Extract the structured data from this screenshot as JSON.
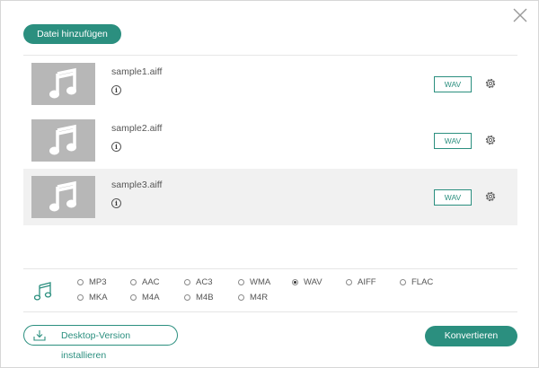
{
  "header": {
    "add_button_label": "Datei hinzufügen"
  },
  "files": [
    {
      "name": "sample1.aiff",
      "format": "WAV"
    },
    {
      "name": "sample2.aiff",
      "format": "WAV"
    },
    {
      "name": "sample3.aiff",
      "format": "WAV"
    }
  ],
  "formats": {
    "options": [
      "MP3",
      "AAC",
      "AC3",
      "WMA",
      "WAV",
      "AIFF",
      "FLAC",
      "MKA",
      "M4A",
      "M4B",
      "M4R"
    ],
    "selected": "WAV"
  },
  "footer": {
    "desktop_label": "Desktop-Version installieren",
    "convert_label": "Konvertieren"
  },
  "colors": {
    "accent": "#2b8f7f",
    "thumb_bg": "#b7b7b7",
    "selected_row_bg": "#f1f1f1"
  },
  "icons": {
    "close": "close-icon",
    "music": "music-note-icon",
    "gear": "gear-icon",
    "info": "info-icon",
    "download": "download-icon"
  }
}
